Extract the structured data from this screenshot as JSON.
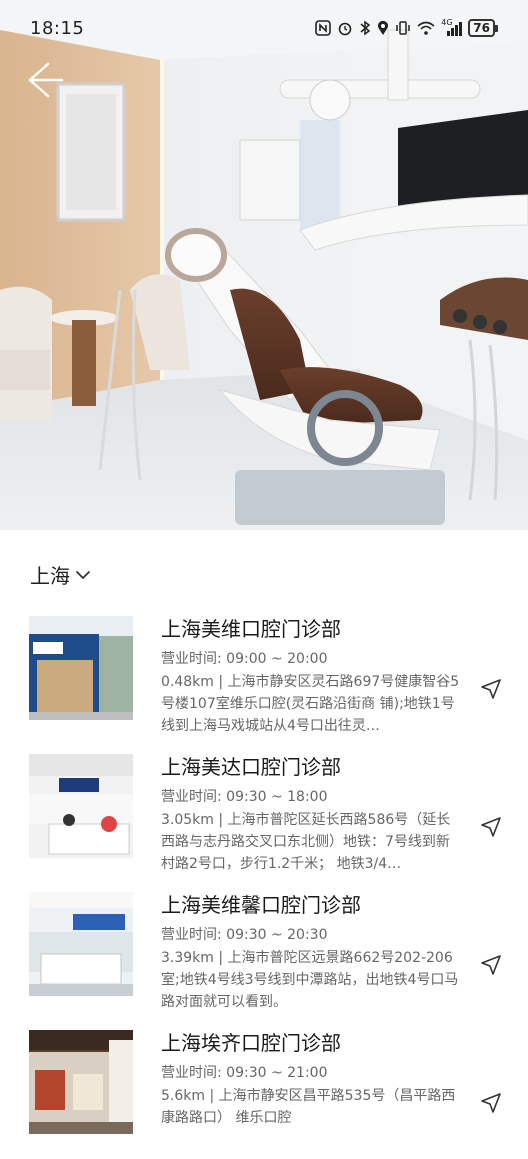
{
  "status_bar": {
    "time": "18:15",
    "signal_label": "4G",
    "battery": "76"
  },
  "hero": {
    "icon": "clinic-interior-photo"
  },
  "city_selector": {
    "label": "上海"
  },
  "clinics": [
    {
      "name": "上海美维口腔门诊部",
      "hours": "营业时间: 09:00 ~ 20:00",
      "address": "0.48km | 上海市静安区灵石路697号健康智谷5号楼107室维乐口腔(灵石路沿街商 铺);地铁1号线到上海马戏城站从4号口出往灵…"
    },
    {
      "name": "上海美达口腔门诊部",
      "hours": "营业时间: 09:30 ~ 18:00",
      "address": "3.05km | 上海市普陀区延长西路586号（延长西路与志丹路交叉口东北侧）地铁：7号线到新村路2号口，步行1.2千米；  地铁3/4…"
    },
    {
      "name": "上海美维馨口腔门诊部",
      "hours": "营业时间: 09:30 ~ 20:30",
      "address": "3.39km | 上海市普陀区远景路662号202-206室;地铁4号线3号线到中潭路站，出地铁4号口马路对面就可以看到。"
    },
    {
      "name": "上海埃齐口腔门诊部",
      "hours": "营业时间: 09:30 ~ 21:00",
      "address": "5.6km | 上海市静安区昌平路535号（昌平路西康路路口） 维乐口腔"
    }
  ]
}
